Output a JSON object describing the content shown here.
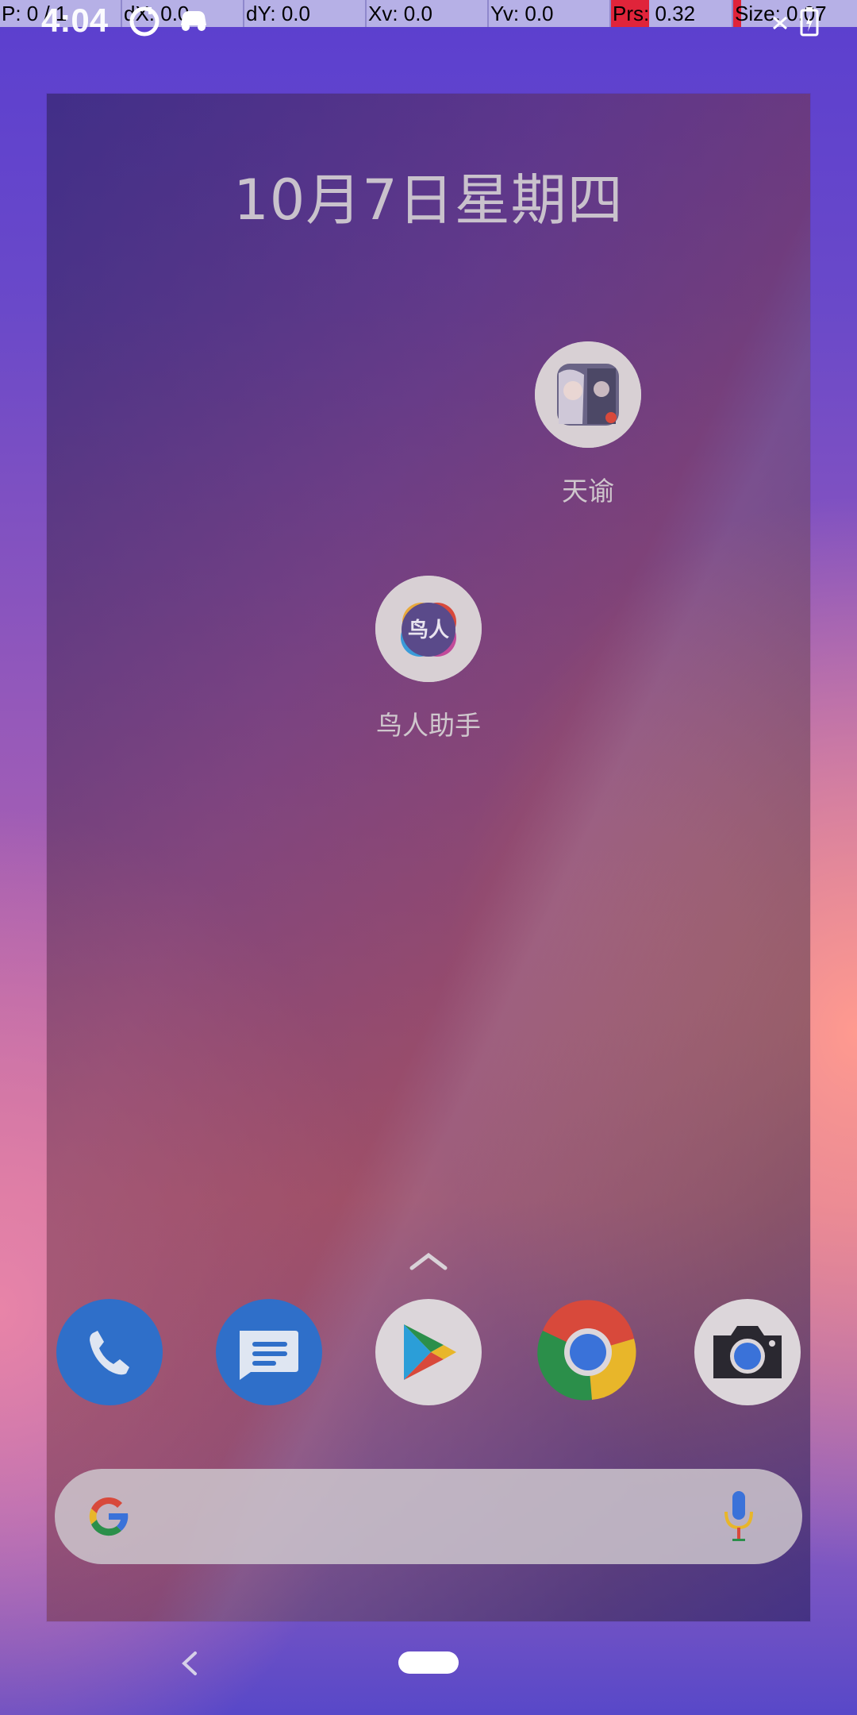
{
  "debug_overlay": {
    "cells": [
      "P: 0 / 1",
      "dX: 0.0",
      "dY: 0.0",
      "Xv: 0.0",
      "Yv: 0.0",
      "Prs: 0.32",
      "Size: 0.07"
    ]
  },
  "status_bar": {
    "time": "4:04"
  },
  "home": {
    "date": "10月7日星期四",
    "apps": [
      {
        "label": "天谕",
        "icon": "game-tianyu-icon"
      },
      {
        "label": "鸟人助手",
        "icon": "niaoren-assistant-icon",
        "icon_text": "鸟人"
      }
    ]
  },
  "dock": {
    "items": [
      "phone-icon",
      "messages-icon",
      "play-store-icon",
      "chrome-icon",
      "camera-icon"
    ]
  },
  "colors": {
    "phone": "#2f6fc9",
    "messages": "#2f6fc9",
    "chrome_red": "#d8493b",
    "chrome_green": "#2b8f4a",
    "chrome_yellow": "#e8b62a",
    "chrome_blue": "#3a72d9"
  }
}
